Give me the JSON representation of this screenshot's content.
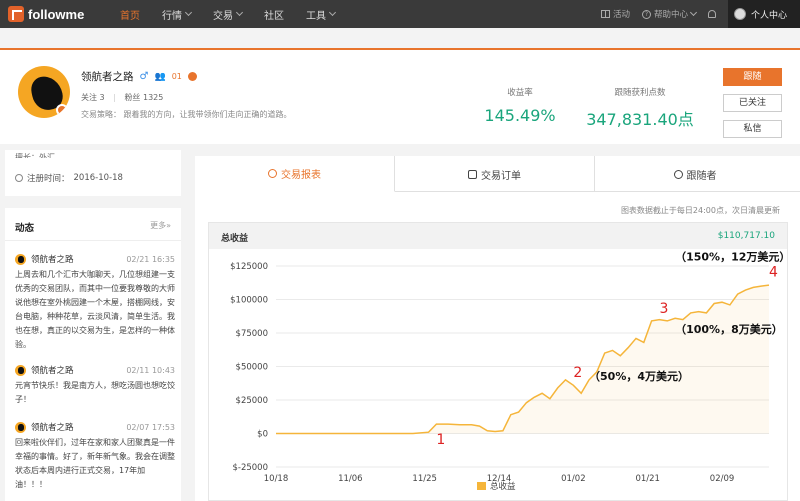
{
  "nav": {
    "logo": "followme",
    "items": [
      {
        "label": "首页",
        "active": true,
        "dropdown": false
      },
      {
        "label": "行情",
        "active": false,
        "dropdown": true
      },
      {
        "label": "交易",
        "active": false,
        "dropdown": true
      },
      {
        "label": "社区",
        "active": false,
        "dropdown": false
      },
      {
        "label": "工具",
        "active": false,
        "dropdown": true
      }
    ],
    "activity": "活动",
    "help": "帮助中心",
    "user": "个人中心"
  },
  "profile": {
    "name": "领航者之路",
    "level": "01",
    "follow_label": "关注",
    "follow_count": "3",
    "fans_label": "粉丝",
    "fans_count": "1325",
    "strategy_label": "交易策略：",
    "strategy": "跟着我的方向，让我带领你们走向正确的道路。",
    "return_label": "收益率",
    "return_value": "145.49%",
    "points_label": "跟随获利点数",
    "points_value": "347,831.40点",
    "buttons": {
      "follow": "跟随",
      "followed": "已关注",
      "message": "私信"
    }
  },
  "sidebar": {
    "truncated_text": "擅长：外汇",
    "register_label": "注册时间：",
    "register_date": "2016-10-18",
    "feed_title": "动态",
    "feed_more": "更多»",
    "posts": [
      {
        "author": "领航者之路",
        "date": "02/21 16:35",
        "text": "上周去和几个汇市大咖聊天，几位想组建一支优秀的交易团队，而其中一位要我尊敬的大师说他想在室外桃园建一个木屋，搭棚网线，安台电脑，种种花草，云淡风清，简单生活。我也在想，真正的以交易为生，是怎样的一种体验。"
      },
      {
        "author": "领航者之路",
        "date": "02/11 10:43",
        "text": "元宵节快乐！我是南方人，想吃汤圆也想吃饺子！"
      },
      {
        "author": "领航者之路",
        "date": "02/07 17:53",
        "text": "回来啦伙伴们，过年在家和家人团聚真是一件幸福的事情。好了，新年新气象。我会在调整状态后本周内进行正式交易，17年加油！！！"
      }
    ]
  },
  "tabs": [
    {
      "label": "交易报表",
      "active": true
    },
    {
      "label": "交易订单",
      "active": false
    },
    {
      "label": "跟随者",
      "active": false
    }
  ],
  "chart_header": {
    "deadline": "图表数据截止于每日24:00点，次日清晨更新",
    "title": "总收益",
    "total": "$110,717.10"
  },
  "chart_data": {
    "type": "area",
    "title": "总收益",
    "legend": "总收益",
    "legend_position": "bottom",
    "ylim": [
      -25000,
      125000
    ],
    "yticks": [
      "$125000",
      "$100000",
      "$75000",
      "$50000",
      "$25000",
      "$0",
      "$-25000"
    ],
    "xticks": [
      "10/18",
      "11/06",
      "11/25",
      "12/14",
      "01/02",
      "01/21",
      "02/09"
    ],
    "grid": true,
    "color": "#f5b53a",
    "x": [
      "10/18",
      "10/25",
      "11/01",
      "11/08",
      "11/15",
      "11/22",
      "11/26",
      "11/28",
      "12/01",
      "12/04",
      "12/07",
      "12/09",
      "12/11",
      "12/13",
      "12/15",
      "12/17",
      "12/19",
      "12/21",
      "12/23",
      "12/25",
      "12/27",
      "12/29",
      "12/31",
      "01/02",
      "01/04",
      "01/06",
      "01/08",
      "01/10",
      "01/12",
      "01/14",
      "01/16",
      "01/18",
      "01/20",
      "01/22",
      "01/24",
      "01/26",
      "01/28",
      "01/30",
      "02/01",
      "02/03",
      "02/05",
      "02/07",
      "02/09",
      "02/11",
      "02/13",
      "02/15",
      "02/17",
      "02/19",
      "02/21"
    ],
    "values": [
      0,
      0,
      0,
      0,
      0,
      0,
      1000,
      7000,
      7000,
      6500,
      6500,
      5500,
      2000,
      1500,
      2000,
      14000,
      16000,
      23000,
      27000,
      30000,
      26000,
      34000,
      40000,
      36000,
      30000,
      40000,
      46000,
      60000,
      62000,
      58000,
      64000,
      71000,
      68000,
      84000,
      85000,
      84000,
      86000,
      85000,
      90000,
      91000,
      90000,
      97000,
      98000,
      96000,
      104000,
      107000,
      109000,
      110000,
      110717
    ],
    "annotations": [
      {
        "x": "11/28",
        "y": -8000,
        "text": "1",
        "color": "#d22"
      },
      {
        "x": "01/02",
        "y": 42000,
        "text": "2",
        "color": "#d22"
      },
      {
        "x": "01/24",
        "y": 90000,
        "text": "3",
        "color": "#d22"
      },
      {
        "x": "02/21",
        "y": 117000,
        "text": "4",
        "color": "#d22"
      },
      {
        "x": "01/06",
        "y": 40000,
        "text": "（50%，4万美元）",
        "color": "#111"
      },
      {
        "x": "01/28",
        "y": 75000,
        "text": "（100%，8万美元）",
        "color": "#111"
      },
      {
        "x": "01/28",
        "y": 129000,
        "text": "（150%，12万美元）",
        "color": "#111"
      }
    ]
  }
}
